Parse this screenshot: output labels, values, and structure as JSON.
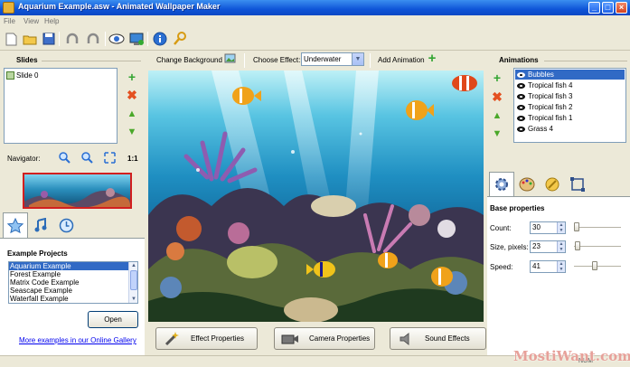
{
  "window": {
    "title": "Aquarium Example.asw - Animated Wallpaper Maker",
    "min": "_",
    "max": "□",
    "close": "×"
  },
  "menu": [
    "File",
    "View",
    "Help"
  ],
  "toolbar": {
    "icons": [
      "new-icon",
      "open-folder-icon",
      "save-icon",
      "undo-icon",
      "redo-icon",
      "preview-eye-icon",
      "apply-wallpaper-icon",
      "info-icon",
      "key-icon"
    ]
  },
  "slides": {
    "title": "Slides",
    "items": [
      "Slide 0"
    ]
  },
  "navigator": {
    "label": "Navigator:",
    "ratio": "1:1"
  },
  "examples": {
    "title": "Example Projects",
    "items": [
      "Aquarium Example",
      "Forest Example",
      "Matrix Code Example",
      "Seascape Example",
      "Waterfall Example"
    ],
    "selected_index": 0,
    "open_label": "Open",
    "gallery_link": "More examples in our Online Gallery"
  },
  "center": {
    "change_background": "Change Background",
    "choose_effect_label": "Choose Effect:",
    "effect_value": "Underwater",
    "add_animation": "Add Animation"
  },
  "bottom_buttons": {
    "effect": "Effect Properties",
    "camera": "Camera Properties",
    "sound": "Sound Effects"
  },
  "animations": {
    "title": "Animations",
    "items": [
      "Bubbles",
      "Tropical fish 4",
      "Tropical fish 3",
      "Tropical fish 2",
      "Tropical fish 1",
      "Grass 4"
    ],
    "selected_index": 0
  },
  "base_properties": {
    "title": "Base properties",
    "count_label": "Count:",
    "count_value": "30",
    "size_label": "Size, pixels:",
    "size_value": "23",
    "speed_label": "Speed:",
    "speed_value": "41"
  },
  "status": {
    "num": "NUM"
  },
  "watermark": "MostiWant.com"
}
